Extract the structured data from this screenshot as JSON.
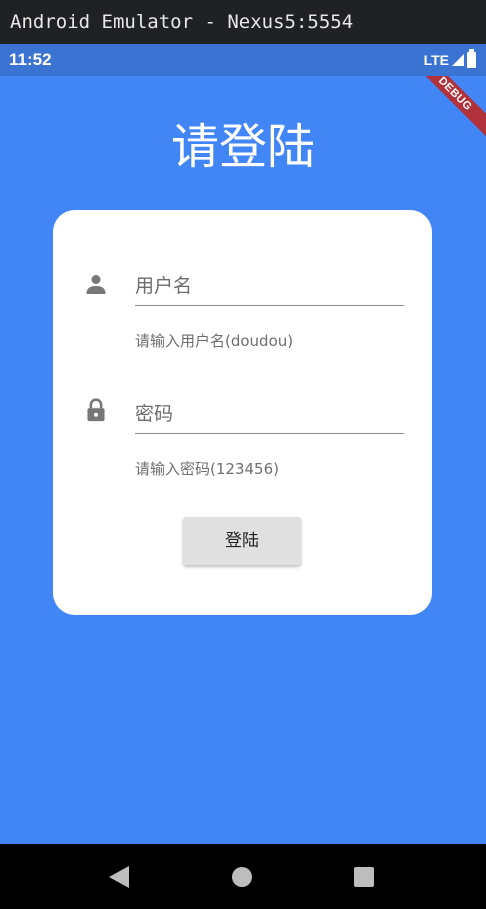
{
  "window": {
    "title": "Android Emulator - Nexus5:5554"
  },
  "status_bar": {
    "time": "11:52",
    "network": "LTE",
    "icons": [
      "signal-icon",
      "battery-icon"
    ]
  },
  "debug_banner": "DEBUG",
  "page": {
    "title": "请登陆"
  },
  "form": {
    "username": {
      "icon": "person-icon",
      "placeholder": "用户名",
      "helper": "请输入用户名(doudou)"
    },
    "password": {
      "icon": "lock-icon",
      "placeholder": "密码",
      "helper": "请输入密码(123456)"
    },
    "submit_label": "登陆"
  },
  "nav_bar": {
    "icons": [
      "back-icon",
      "home-icon",
      "recents-icon"
    ]
  },
  "colors": {
    "background": "#4286f5",
    "status_bar": "#3a73d2",
    "card": "#ffffff",
    "button": "#e0e0e0"
  }
}
